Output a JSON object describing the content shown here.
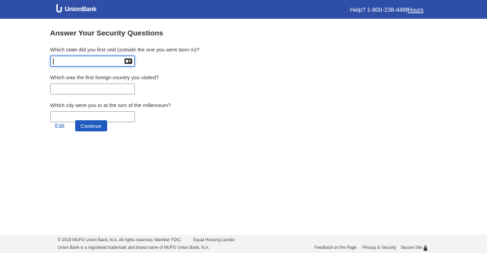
{
  "header": {
    "logo_text": "UnionBank",
    "help_text": "Help? 1-800-238-4486",
    "hours_label": "Hours",
    "brand_color": "#2f4ea8"
  },
  "main": {
    "title": "Answer Your Security Questions",
    "questions": [
      {
        "label": "Which state did you first visit (outside the one you were born in)?",
        "value": ""
      },
      {
        "label": "Which was the first foreign country you visited?",
        "value": ""
      },
      {
        "label": "Which city were you in at the turn of the millennium?",
        "value": ""
      }
    ],
    "edit_label": "Edit",
    "continue_label": "Continue",
    "button_color": "#1f5bbf"
  },
  "footer": {
    "copyright": "© 2019 MUFG Union Bank, N.A. All rights reserved. Member FDIC.",
    "equal_housing": "Equal Housing Lender",
    "trademark": "Union Bank is a registered trademark and brand name of MUFG Union Bank, N.A.",
    "feedback": "Feedback on the Page",
    "privacy": "Privacy & Security",
    "secure": "Secure Site"
  }
}
